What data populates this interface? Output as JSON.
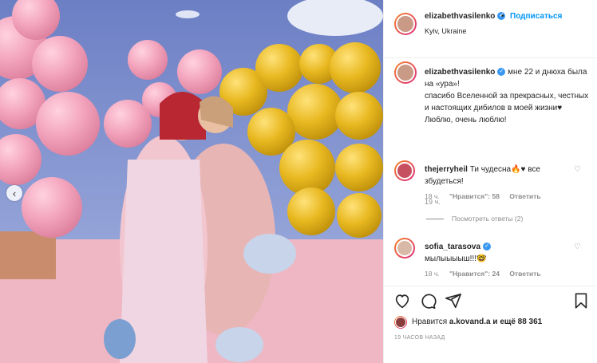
{
  "header": {
    "username": "elizabethvasilenko",
    "separator": "•",
    "follow_label": "Подписаться",
    "location": "Kyiv, Ukraine"
  },
  "caption": {
    "username": "elizabethvasilenko",
    "text": "мне 22 и днюха была на «ура»!\nспасибо Вселенной за прекрасных, честных и настоящих дибилов в моей жизни♥\nЛюблю, очень люблю!",
    "time": "19 ч."
  },
  "comments": [
    {
      "username": "thejerryheil",
      "text": "Ти чудесна🔥♥ все збудеться!",
      "time": "18 ч.",
      "likes": "\"Нравится\": 58",
      "reply_label": "Ответить"
    },
    {
      "username": "sofia_tarasova",
      "text": "мылыыыыш!!!🤓",
      "time": "18 ч.",
      "likes": "\"Нравится\": 24",
      "reply_label": "Ответить"
    }
  ],
  "replies_label": "Посмотреть ответы (2)",
  "likes": {
    "prefix": "Нравится ",
    "user": "a.kovand.a",
    "suffix": " и ещё 88 361"
  },
  "post_time": "19 ЧАСОВ НАЗАД",
  "icons": {
    "like": "heart-icon",
    "comment": "comment-icon",
    "share": "share-icon",
    "save": "bookmark-icon",
    "carousel_prev": "chevron-left-icon"
  },
  "colors": {
    "accent": "#0095f6",
    "verified": "#3897f0",
    "muted": "#8e8e8e"
  }
}
